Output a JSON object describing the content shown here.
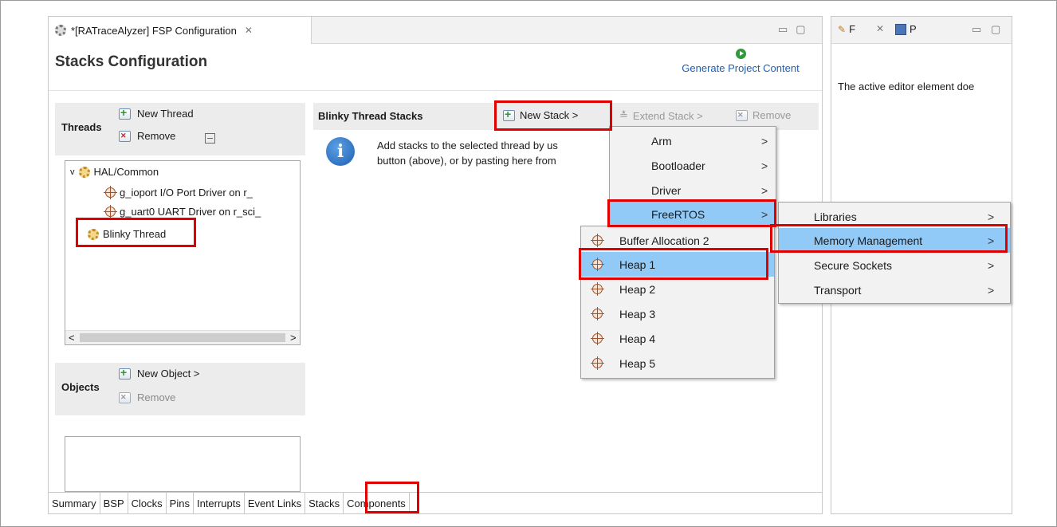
{
  "editor": {
    "tab_title": "*[RATraceAlyzer] FSP Configuration",
    "tab_close": "✕",
    "page_title": "Stacks Configuration",
    "generate_label": "Generate Project Content",
    "win_min": "▭",
    "win_max": "▢"
  },
  "threads": {
    "label": "Threads",
    "new_thread": "New Thread",
    "remove": "Remove",
    "tree": [
      {
        "label": "HAL/Common",
        "expander": "v",
        "icon": "gear-icon"
      },
      {
        "label": "g_ioport I/O Port Driver on r_",
        "icon": "target-icon"
      },
      {
        "label": "g_uart0 UART Driver on r_sci_",
        "icon": "target-icon"
      },
      {
        "label": "Blinky Thread",
        "icon": "gear-icon",
        "selected": true
      }
    ],
    "scroll_left": "<",
    "scroll_right": ">"
  },
  "objects": {
    "label": "Objects",
    "new_object": "New Object >",
    "remove": "Remove"
  },
  "stacks": {
    "label": "Blinky Thread Stacks",
    "new_stack": "New Stack >",
    "extend_stack": "Extend Stack >",
    "remove": "Remove",
    "info_line1": "Add stacks to the selected thread by us",
    "info_line2": "button (above), or by pasting here from"
  },
  "bottom_tabs": [
    "Summary",
    "BSP",
    "Clocks",
    "Pins",
    "Interrupts",
    "Event Links",
    "Stacks",
    "Components"
  ],
  "right_view": {
    "tab1": "F",
    "tab2": "P",
    "message": "The active editor element doe"
  },
  "menus": {
    "new_stack_menu": [
      {
        "label": "Arm",
        "arrow": ">"
      },
      {
        "label": "Bootloader",
        "arrow": ">"
      },
      {
        "label": "Driver",
        "arrow": ">"
      },
      {
        "label": "FreeRTOS",
        "arrow": ">",
        "highlighted": true
      }
    ],
    "freertos_menu": [
      {
        "label": "Libraries",
        "arrow": ">"
      },
      {
        "label": "Memory Management",
        "arrow": ">",
        "highlighted": true
      },
      {
        "label": "Secure Sockets",
        "arrow": ">"
      },
      {
        "label": "Transport",
        "arrow": ">"
      }
    ],
    "memory_menu": [
      {
        "label": "Buffer Allocation 2"
      },
      {
        "label": "Heap 1",
        "highlighted": true
      },
      {
        "label": "Heap 2"
      },
      {
        "label": "Heap 3"
      },
      {
        "label": "Heap 4"
      },
      {
        "label": "Heap 5"
      }
    ]
  },
  "colors": {
    "highlight": "#91c9f7",
    "annotation_red": "#e00000",
    "link_blue": "#1f5fb0"
  }
}
